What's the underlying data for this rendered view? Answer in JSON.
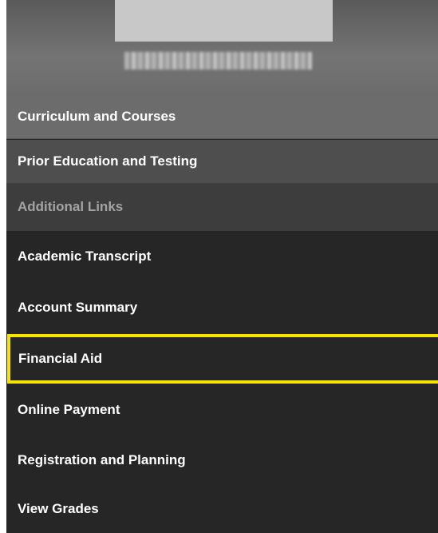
{
  "sidebar": {
    "sections": {
      "curriculum": "Curriculum and Courses",
      "prior_education": "Prior Education and Testing",
      "additional_links": "Additional Links"
    },
    "links": {
      "academic_transcript": "Academic Transcript",
      "account_summary": "Account Summary",
      "financial_aid": "Financial Aid",
      "online_payment": "Online Payment",
      "registration_planning": "Registration and Planning",
      "view_grades": "View Grades"
    },
    "highlighted_item": "Financial Aid",
    "highlight_color": "#f5e400"
  }
}
